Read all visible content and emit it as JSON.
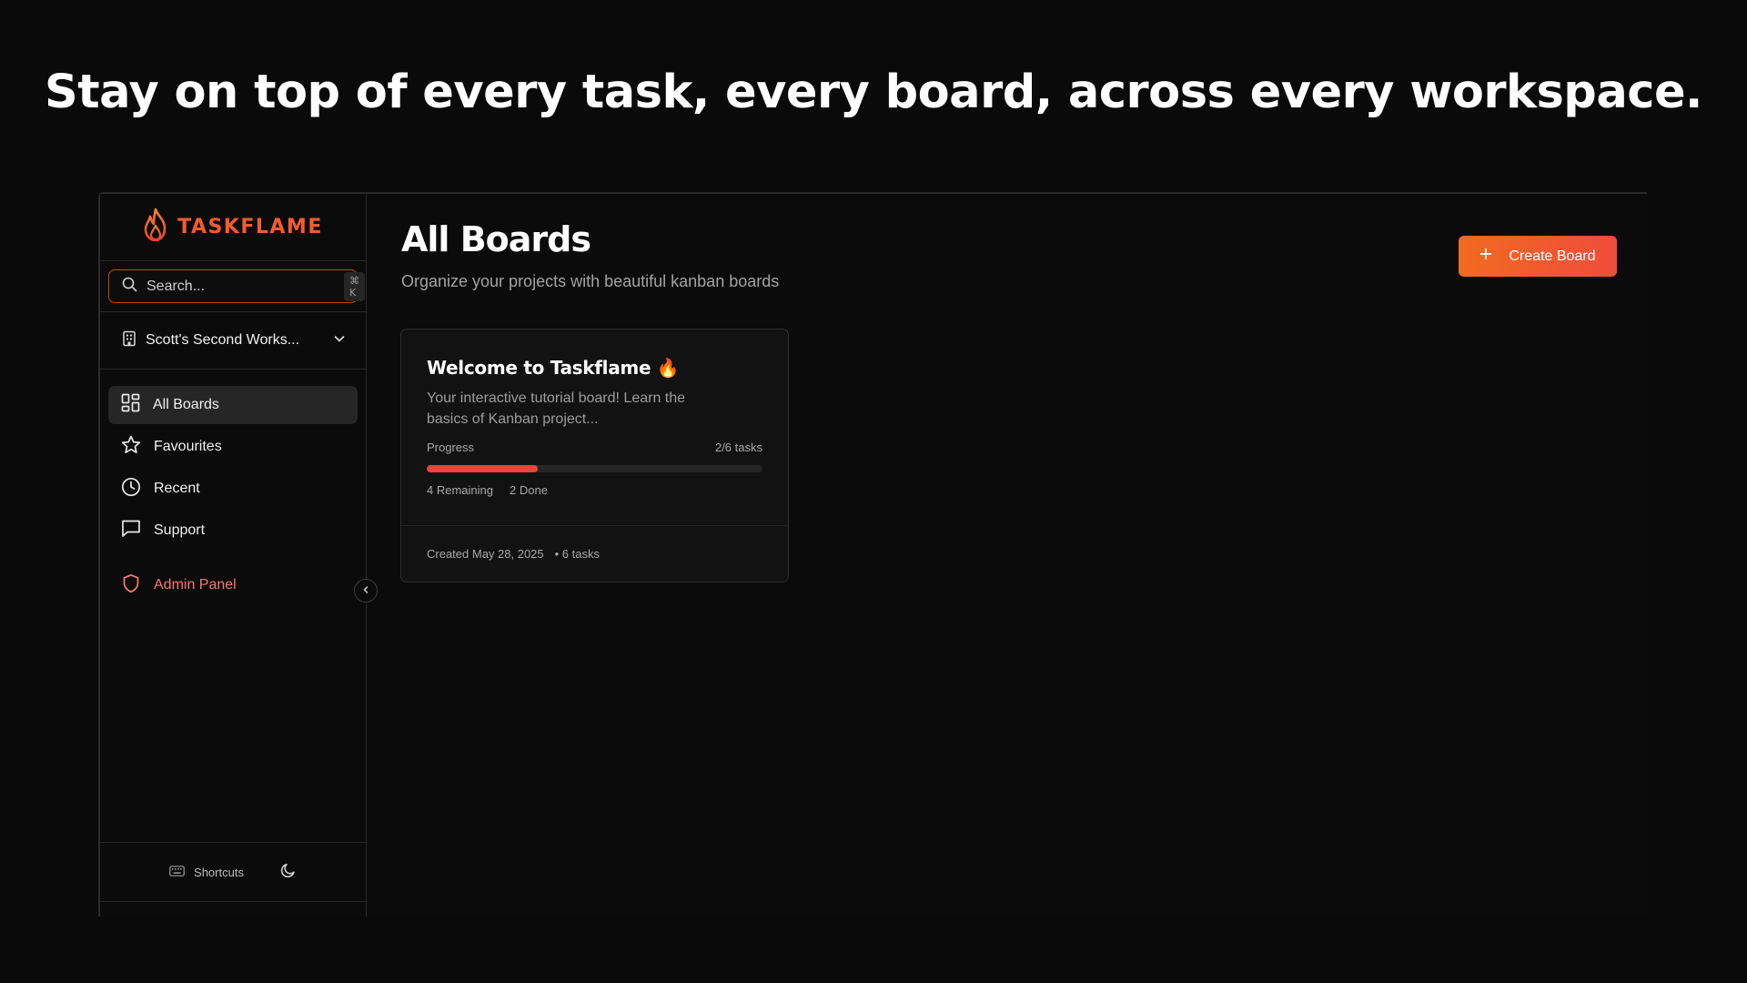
{
  "headline": "Stay on top of every task, every board, across every workspace.",
  "brand": {
    "name": "TASKFLAME",
    "accent": "#f25c2e"
  },
  "search": {
    "placeholder": "Search...",
    "shortcut": "⌘ K"
  },
  "workspace": {
    "name": "Scott's Second Works..."
  },
  "nav": {
    "items": [
      {
        "label": "All Boards",
        "icon": "grid-icon",
        "active": true
      },
      {
        "label": "Favourites",
        "icon": "star-icon",
        "active": false
      },
      {
        "label": "Recent",
        "icon": "clock-icon",
        "active": false
      },
      {
        "label": "Support",
        "icon": "chat-icon",
        "active": false
      }
    ],
    "admin": {
      "label": "Admin Panel",
      "icon": "shield-icon",
      "color": "#f07a6a"
    }
  },
  "footer": {
    "shortcuts_label": "Shortcuts"
  },
  "main": {
    "title": "All Boards",
    "subtitle": "Organize your projects with beautiful kanban boards",
    "create_label": "Create Board"
  },
  "board": {
    "title": "Welcome to Taskflame 🔥",
    "description": "Your interactive tutorial board! Learn the basics of Kanban project...",
    "progress_label": "Progress",
    "progress_count": "2/6 tasks",
    "progress_fraction": 0.33,
    "remaining": "4 Remaining",
    "done": "2 Done",
    "created": "Created May 28, 2025",
    "task_count": "• 6 tasks"
  }
}
